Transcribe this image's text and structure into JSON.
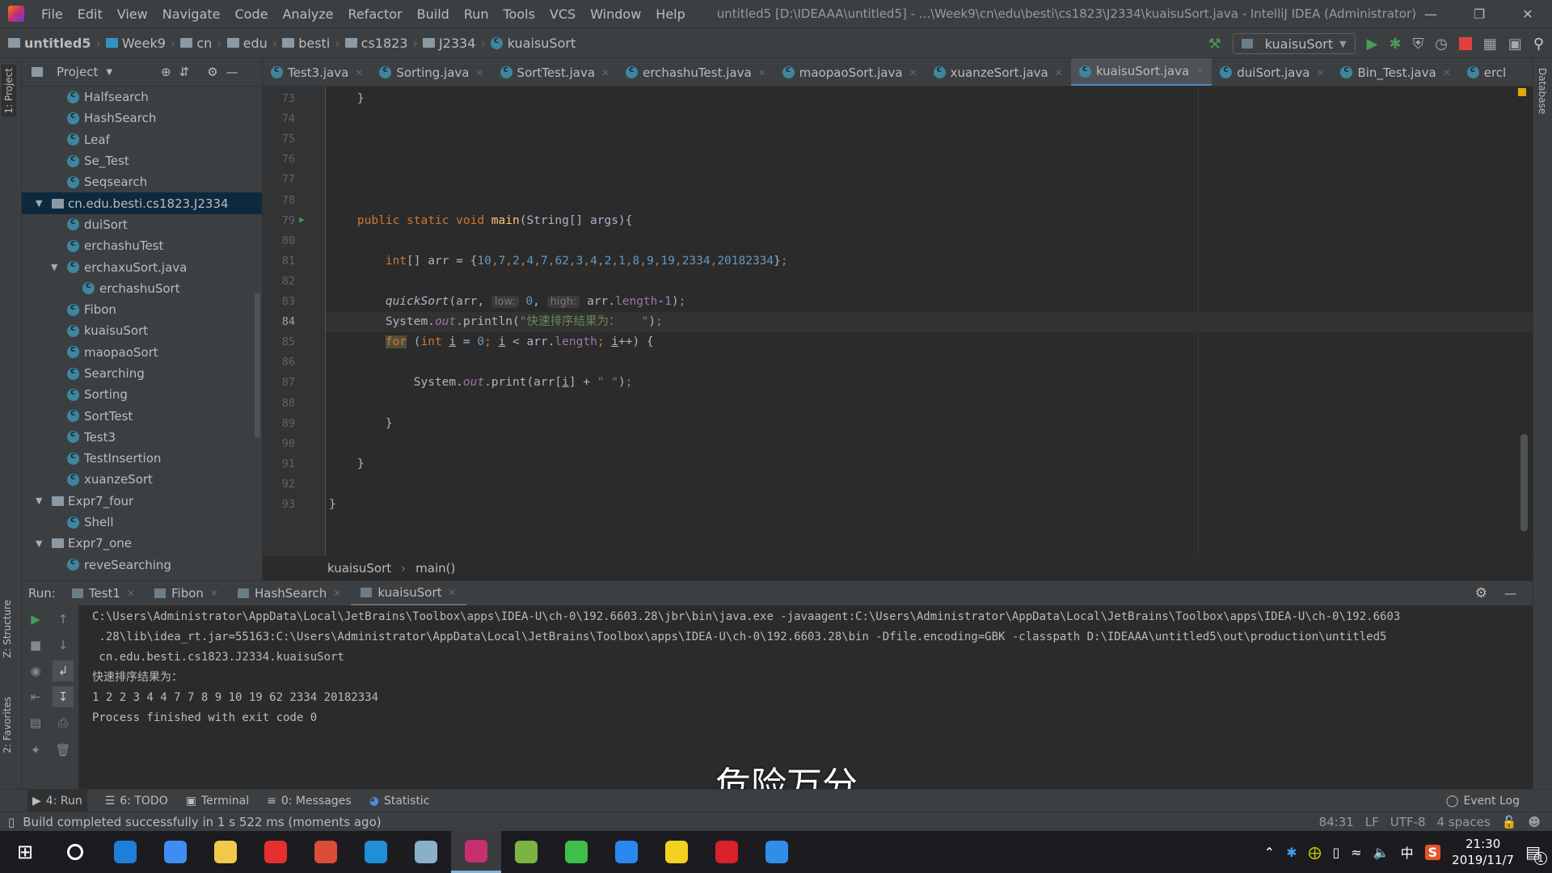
{
  "titlebar": {
    "menu": [
      "File",
      "Edit",
      "View",
      "Navigate",
      "Code",
      "Analyze",
      "Refactor",
      "Build",
      "Run",
      "Tools",
      "VCS",
      "Window",
      "Help"
    ],
    "title": "untitled5 [D:\\IDEAAA\\untitled5] - ...\\Week9\\cn\\edu\\besti\\cs1823\\J2334\\kuaisuSort.java - IntelliJ IDEA (Administrator)"
  },
  "navbar": {
    "crumbs": [
      "untitled5",
      "Week9",
      "cn",
      "edu",
      "besti",
      "cs1823",
      "J2334",
      "kuaisuSort"
    ],
    "run_config": "kuaisuSort"
  },
  "left_stripe": {
    "project": "1: Project",
    "structure": "Z: Structure",
    "favorites": "2: Favorites"
  },
  "right_stripe": {
    "database": "Database"
  },
  "project": {
    "title": "Project",
    "items": [
      {
        "label": "Halfsearch",
        "level": 2,
        "type": "class"
      },
      {
        "label": "HashSearch",
        "level": 2,
        "type": "class"
      },
      {
        "label": "Leaf",
        "level": 2,
        "type": "class"
      },
      {
        "label": "Se_Test",
        "level": 2,
        "type": "class"
      },
      {
        "label": "Seqsearch",
        "level": 2,
        "type": "class"
      },
      {
        "label": "cn.edu.besti.cs1823.J2334",
        "level": 1,
        "type": "package",
        "expanded": true,
        "selected": true
      },
      {
        "label": "duiSort",
        "level": 2,
        "type": "class"
      },
      {
        "label": "erchashuTest",
        "level": 2,
        "type": "class"
      },
      {
        "label": "erchaxuSort.java",
        "level": 2,
        "type": "file",
        "expanded": true
      },
      {
        "label": "erchashuSort",
        "level": 3,
        "type": "class"
      },
      {
        "label": "Fibon",
        "level": 2,
        "type": "class"
      },
      {
        "label": "kuaisuSort",
        "level": 2,
        "type": "class"
      },
      {
        "label": "maopaoSort",
        "level": 2,
        "type": "class"
      },
      {
        "label": "Searching",
        "level": 2,
        "type": "class"
      },
      {
        "label": "Sorting",
        "level": 2,
        "type": "class"
      },
      {
        "label": "SortTest",
        "level": 2,
        "type": "class"
      },
      {
        "label": "Test3",
        "level": 2,
        "type": "class"
      },
      {
        "label": "TestInsertion",
        "level": 2,
        "type": "class"
      },
      {
        "label": "xuanzeSort",
        "level": 2,
        "type": "class"
      },
      {
        "label": "Expr7_four",
        "level": 1,
        "type": "package",
        "expanded": true
      },
      {
        "label": "Shell",
        "level": 2,
        "type": "class"
      },
      {
        "label": "Expr7_one",
        "level": 1,
        "type": "package",
        "expanded": true
      },
      {
        "label": "reveSearching",
        "level": 2,
        "type": "class"
      }
    ]
  },
  "tabs": [
    {
      "label": "Test3.java"
    },
    {
      "label": "Sorting.java"
    },
    {
      "label": "SortTest.java"
    },
    {
      "label": "erchashuTest.java"
    },
    {
      "label": "maopaoSort.java"
    },
    {
      "label": "xuanzeSort.java"
    },
    {
      "label": "kuaisuSort.java",
      "active": true
    },
    {
      "label": "duiSort.java"
    },
    {
      "label": "Bin_Test.java"
    },
    {
      "label": "ercl"
    }
  ],
  "editor": {
    "current_line": 84,
    "lines": [
      {
        "n": 73,
        "t": [
          [
            "    }",
            ""
          ]
        ]
      },
      {
        "n": 74,
        "t": []
      },
      {
        "n": 75,
        "t": []
      },
      {
        "n": 76,
        "t": []
      },
      {
        "n": 77,
        "t": []
      },
      {
        "n": 78,
        "t": []
      },
      {
        "n": 79,
        "run": true,
        "t": [
          [
            "    ",
            ""
          ],
          [
            "public static void ",
            "kw"
          ],
          [
            "main",
            "fn"
          ],
          [
            "(String[] args){",
            ""
          ]
        ]
      },
      {
        "n": 80,
        "t": []
      },
      {
        "n": 81,
        "t": [
          [
            "        ",
            ""
          ],
          [
            "int",
            "kw"
          ],
          [
            "[] arr = {",
            ""
          ],
          [
            "10",
            "num"
          ],
          [
            ",",
            "kw"
          ],
          [
            "7",
            "num"
          ],
          [
            ",",
            "kw"
          ],
          [
            "2",
            "num"
          ],
          [
            ",",
            "kw"
          ],
          [
            "4",
            "num"
          ],
          [
            ",",
            "kw"
          ],
          [
            "7",
            "num"
          ],
          [
            ",",
            "kw"
          ],
          [
            "62",
            "num"
          ],
          [
            ",",
            "kw"
          ],
          [
            "3",
            "num"
          ],
          [
            ",",
            "kw"
          ],
          [
            "4",
            "num"
          ],
          [
            ",",
            "kw"
          ],
          [
            "2",
            "num"
          ],
          [
            ",",
            "kw"
          ],
          [
            "1",
            "num"
          ],
          [
            ",",
            "kw"
          ],
          [
            "8",
            "num"
          ],
          [
            ",",
            "kw"
          ],
          [
            "9",
            "num"
          ],
          [
            ",",
            "kw"
          ],
          [
            "19",
            "num"
          ],
          [
            ",",
            "kw"
          ],
          [
            "2334",
            "num"
          ],
          [
            ",",
            "kw"
          ],
          [
            "20182334",
            "num"
          ],
          [
            "}",
            ""
          ],
          [
            ";",
            "kw"
          ]
        ]
      },
      {
        "n": 82,
        "t": []
      },
      {
        "n": 83,
        "t": [
          [
            "        ",
            ""
          ],
          [
            "quickSort",
            "it"
          ],
          [
            "(arr, ",
            ""
          ],
          [
            "low:",
            "hint"
          ],
          [
            " ",
            ""
          ],
          [
            "0",
            "num"
          ],
          [
            ", ",
            ""
          ],
          [
            "high:",
            "hint"
          ],
          [
            " arr.",
            ""
          ],
          [
            "length",
            "fld"
          ],
          [
            "-",
            ""
          ],
          [
            "1",
            "num"
          ],
          [
            ")",
            ""
          ],
          [
            ";",
            "kw"
          ]
        ]
      },
      {
        "n": 84,
        "t": [
          [
            "        System.",
            ""
          ],
          [
            "out",
            "fld it"
          ],
          [
            ".println(",
            ""
          ],
          [
            "\"快速排序结果为：   \"",
            "str"
          ],
          [
            ")",
            ""
          ],
          [
            ";",
            "kw"
          ]
        ]
      },
      {
        "n": 85,
        "t": [
          [
            "        ",
            ""
          ],
          [
            "for",
            "kw hl"
          ],
          [
            " (",
            ""
          ],
          [
            "int ",
            "kw"
          ],
          [
            "i",
            "u"
          ],
          [
            " = ",
            ""
          ],
          [
            "0",
            "num"
          ],
          [
            "; ",
            "kw"
          ],
          [
            "i",
            "u"
          ],
          [
            " < arr.",
            ""
          ],
          [
            "length",
            "fld"
          ],
          [
            "; ",
            "kw"
          ],
          [
            "i",
            "u"
          ],
          [
            "++) {",
            ""
          ]
        ]
      },
      {
        "n": 86,
        "t": []
      },
      {
        "n": 87,
        "t": [
          [
            "            System.",
            ""
          ],
          [
            "out",
            "fld it"
          ],
          [
            ".print(arr[",
            ""
          ],
          [
            "i",
            "u"
          ],
          [
            "] + ",
            ""
          ],
          [
            "\" \"",
            "str"
          ],
          [
            ")",
            ""
          ],
          [
            ";",
            "kw"
          ]
        ]
      },
      {
        "n": 88,
        "t": []
      },
      {
        "n": 89,
        "t": [
          [
            "        }",
            ""
          ]
        ]
      },
      {
        "n": 90,
        "t": []
      },
      {
        "n": 91,
        "t": [
          [
            "    }",
            ""
          ]
        ]
      },
      {
        "n": 92,
        "t": []
      },
      {
        "n": 93,
        "t": [
          [
            "}",
            ""
          ]
        ]
      }
    ]
  },
  "breadcrumb": {
    "class": "kuaisuSort",
    "method": "main()"
  },
  "run": {
    "label": "Run:",
    "tabs": [
      {
        "label": "Test1"
      },
      {
        "label": "Fibon"
      },
      {
        "label": "HashSearch"
      },
      {
        "label": "kuaisuSort",
        "active": true
      }
    ],
    "console": [
      "C:\\Users\\Administrator\\AppData\\Local\\JetBrains\\Toolbox\\apps\\IDEA-U\\ch-0\\192.6603.28\\jbr\\bin\\java.exe -javaagent:C:\\Users\\Administrator\\AppData\\Local\\JetBrains\\Toolbox\\apps\\IDEA-U\\ch-0\\192.6603",
      " .28\\lib\\idea_rt.jar=55163:C:\\Users\\Administrator\\AppData\\Local\\JetBrains\\Toolbox\\apps\\IDEA-U\\ch-0\\192.6603.28\\bin -Dfile.encoding=GBK -classpath D:\\IDEAAA\\untitled5\\out\\production\\untitled5",
      " cn.edu.besti.cs1823.J2334.kuaisuSort",
      "快速排序结果为：",
      "1 2 2 3 4 4 7 7 8 9 10 19 62 2334 20182334",
      "Process finished with exit code 0"
    ]
  },
  "subtitle": "危险万分",
  "bottom_tools": [
    {
      "label": "4: Run",
      "icon": "run-icon",
      "active": true
    },
    {
      "label": "6: TODO",
      "icon": "list-icon"
    },
    {
      "label": "Terminal",
      "icon": "terminal-icon"
    },
    {
      "label": "0: Messages",
      "icon": "messages-icon"
    },
    {
      "label": "Statistic",
      "icon": "statistic-icon"
    }
  ],
  "event_log": "Event Log",
  "status": {
    "message": "Build completed successfully in 1 s 522 ms (moments ago)",
    "position": "84:31",
    "line_sep": "LF",
    "encoding": "UTF-8",
    "indent": "4 spaces"
  },
  "taskbar": {
    "apps": [
      {
        "icon": "edge-icon",
        "color": "#1e7fd8"
      },
      {
        "icon": "notes-icon",
        "color": "#3d8ef0"
      },
      {
        "icon": "file-explorer-icon",
        "color": "#f2c84b"
      },
      {
        "icon": "youdao-icon",
        "color": "#e62e2e"
      },
      {
        "icon": "chrome-icon",
        "color": "#dd4b39"
      },
      {
        "icon": "app-icon",
        "color": "#1f8fd6"
      },
      {
        "icon": "paint-icon",
        "color": "#8ab0c8"
      },
      {
        "icon": "intellij-icon",
        "color": "#c7306f",
        "active": true
      },
      {
        "icon": "android-studio-icon",
        "color": "#7cb342"
      },
      {
        "icon": "wechat-icon",
        "color": "#3fbf4a"
      },
      {
        "icon": "dingtalk-icon",
        "color": "#2a87f0"
      },
      {
        "icon": "music-icon",
        "color": "#f3d21f"
      },
      {
        "icon": "netease-music-icon",
        "color": "#d9222a"
      },
      {
        "icon": "phone-app-icon",
        "color": "#2f8fe8"
      }
    ],
    "ime": "中",
    "time": "21:30",
    "date": "2019/11/7",
    "notifications": "1"
  }
}
